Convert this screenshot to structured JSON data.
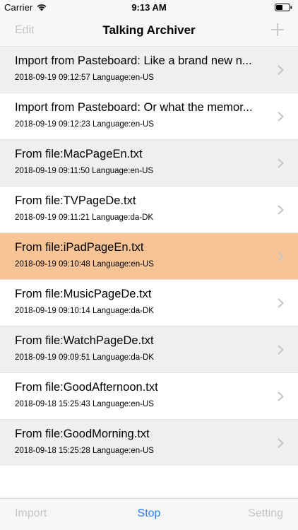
{
  "status_bar": {
    "carrier": "Carrier",
    "time": "9:13 AM",
    "wifi_icon": "wifi-icon",
    "battery_icon": "battery-icon"
  },
  "nav": {
    "edit_label": "Edit",
    "title": "Talking Archiver",
    "add_icon": "plus-icon"
  },
  "rows": [
    {
      "title": "Import from Pasteboard: Like a brand new n...",
      "subtitle": "2018-09-19 09:12:57 Language:en-US",
      "state": "alt"
    },
    {
      "title": "Import from Pasteboard: Or what the memor...",
      "subtitle": "2018-09-19 09:12:23 Language:en-US",
      "state": "normal"
    },
    {
      "title": "From file:MacPageEn.txt",
      "subtitle": "2018-09-19 09:11:50 Language:en-US",
      "state": "alt"
    },
    {
      "title": "From file:TVPageDe.txt",
      "subtitle": "2018-09-19 09:11:21 Language:da-DK",
      "state": "normal"
    },
    {
      "title": "From file:iPadPageEn.txt",
      "subtitle": "2018-09-19 09:10:48 Language:en-US",
      "state": "selected"
    },
    {
      "title": "From file:MusicPageDe.txt",
      "subtitle": "2018-09-19 09:10:14 Language:da-DK",
      "state": "normal"
    },
    {
      "title": "From file:WatchPageDe.txt",
      "subtitle": "2018-09-19 09:09:51 Language:da-DK",
      "state": "alt"
    },
    {
      "title": "From file:GoodAfternoon.txt",
      "subtitle": "2018-09-18 15:25:43 Language:en-US",
      "state": "normal"
    },
    {
      "title": "From file:GoodMorning.txt",
      "subtitle": "2018-09-18 15:25:28 Language:en-US",
      "state": "alt"
    }
  ],
  "toolbar": {
    "import_label": "Import",
    "stop_label": "Stop",
    "setting_label": "Setting"
  },
  "colors": {
    "selected_row": "#f9c495",
    "alt_row": "#efefef",
    "accent": "#2a7cf6",
    "disabled": "#c6c6c8"
  }
}
